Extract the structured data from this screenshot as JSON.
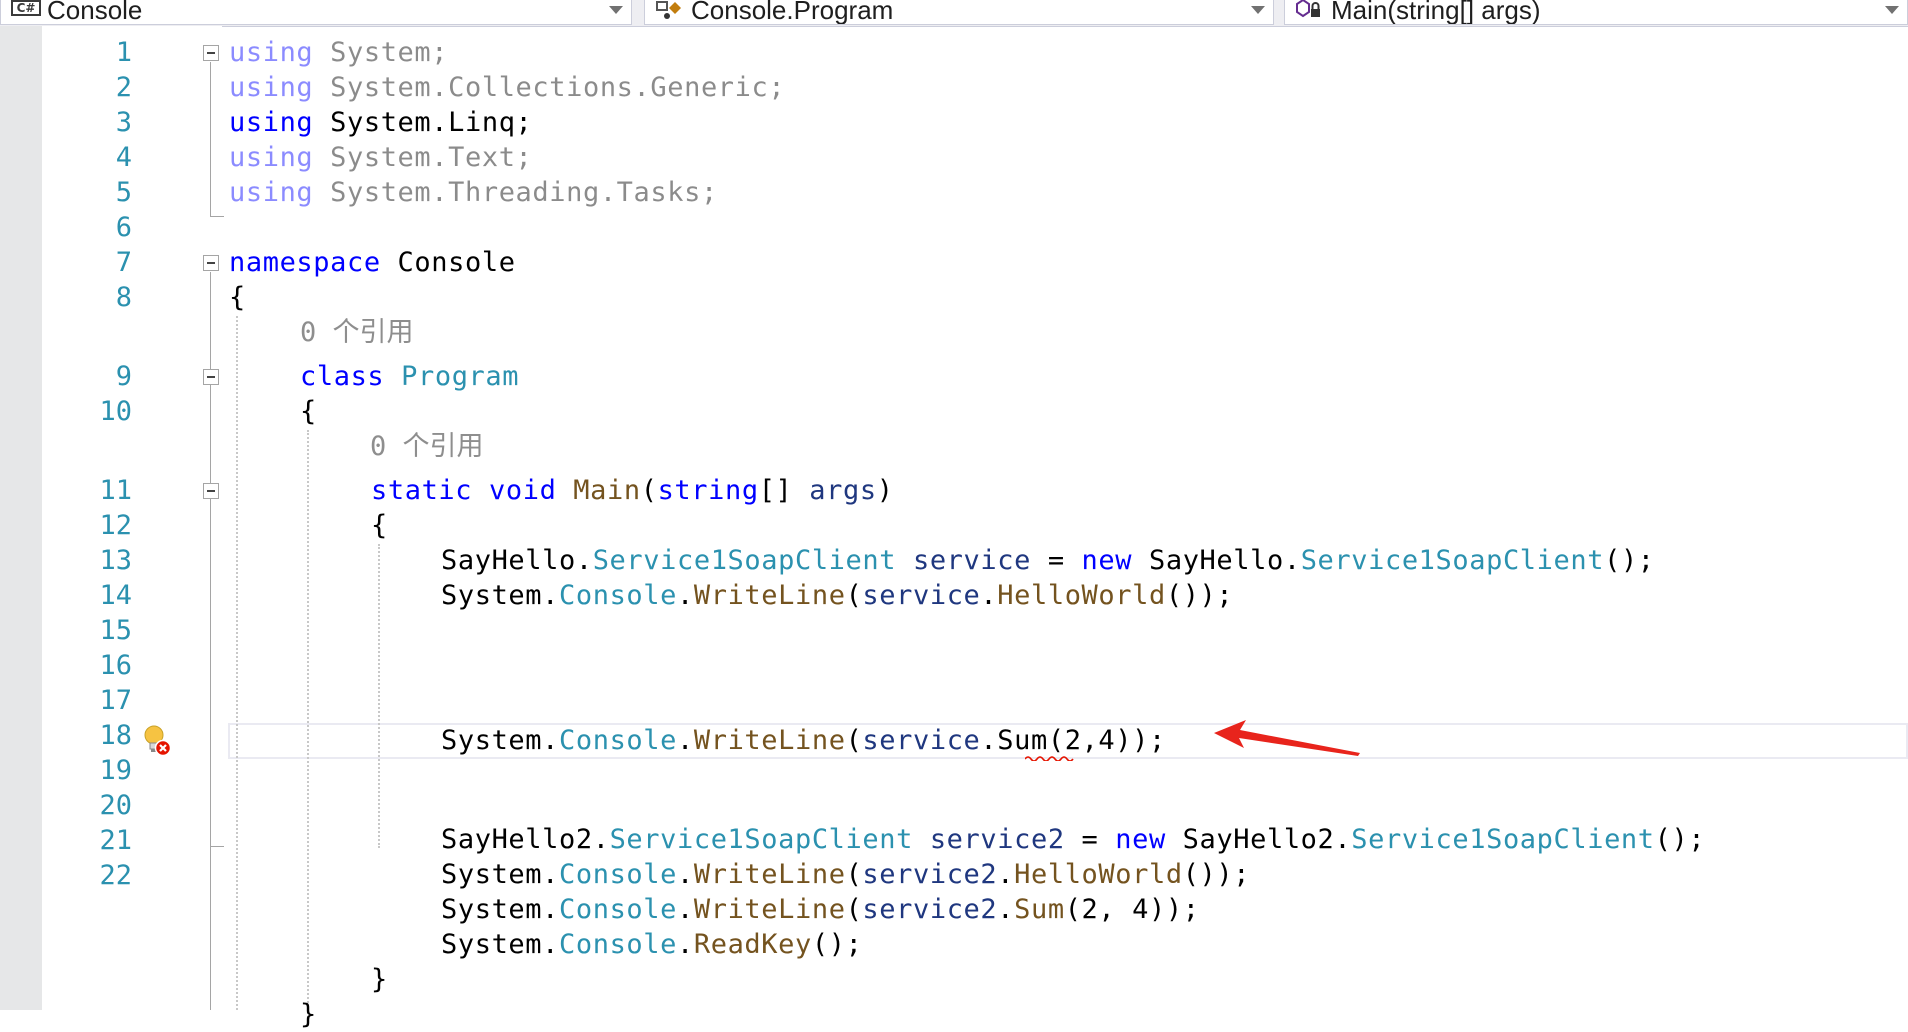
{
  "navbar": {
    "project": "Console",
    "type_scope": "Console.Program",
    "member": "Main(string[] args)",
    "project_icon": "csharp-project-icon",
    "type_icon": "class-icon",
    "member_icon": "method-icon"
  },
  "codelens": {
    "program_refs": "0 个引用",
    "main_refs": "0 个引用"
  },
  "line_numbers": [
    "1",
    "2",
    "3",
    "4",
    "5",
    "6",
    "7",
    "8",
    "9",
    "10",
    "11",
    "12",
    "13",
    "14",
    "15",
    "16",
    "17",
    "18",
    "19",
    "20",
    "21",
    "22"
  ],
  "code": {
    "l1": {
      "kw": "using",
      "rest": " System;"
    },
    "l2": {
      "kw": "using",
      "rest": " System.Collections.Generic;"
    },
    "l3": {
      "kw": "using",
      "rest": " System.Linq;"
    },
    "l4": {
      "kw": "using",
      "rest": " System.Text;"
    },
    "l5": {
      "kw": "using",
      "rest": " System.Threading.Tasks;"
    },
    "l7": {
      "kw": "namespace",
      "rest": " Console"
    },
    "l8": "{",
    "l9": {
      "kw": "class",
      "sp": " ",
      "ty": "Program"
    },
    "l10": "{",
    "l11": {
      "kw1": "static",
      "sp1": " ",
      "kw2": "void",
      "sp2": " ",
      "mt": "Main",
      "p1": "(",
      "kw3": "string",
      "p2": "[] ",
      "pm": "args",
      "p3": ")"
    },
    "l12": "{",
    "l13": {
      "a": "SayHello.",
      "ty1": "Service1SoapClient",
      "sp": " ",
      "pm": "service",
      "b": " = ",
      "kw": "new",
      "c": " SayHello.",
      "ty2": "Service1SoapClient",
      "d": "();"
    },
    "l14": {
      "a": "System.",
      "ty": "Console",
      "b": ".",
      "mt1": "WriteLine",
      "c": "(",
      "pm": "service",
      "d": ".",
      "mt2": "HelloWorld",
      "e": "());"
    },
    "l15": {
      "a": "System.",
      "ty": "Console",
      "b": ".",
      "mt": "WriteLine",
      "c": "(",
      "pm": "service",
      "d": ".",
      "err": "Sum",
      "e": "(2,4));"
    },
    "l17": {
      "a": "SayHello2.",
      "ty1": "Service1SoapClient",
      "sp": " ",
      "pm": "service2",
      "b": " = ",
      "kw": "new",
      "c": " SayHello2.",
      "ty2": "Service1SoapClient",
      "d": "();"
    },
    "l18": {
      "a": "System.",
      "ty": "Console",
      "b": ".",
      "mt1": "WriteLine",
      "c": "(",
      "pm": "service2",
      "d": ".",
      "mt2": "HelloWorld",
      "e": "());"
    },
    "l19": {
      "a": "System.",
      "ty": "Console",
      "b": ".",
      "mt1": "WriteLine",
      "c": "(",
      "pm": "service2",
      "d": ".",
      "mt2": "Sum",
      "e": "(2, 4));"
    },
    "l20": {
      "a": "System.",
      "ty": "Console",
      "b": ".",
      "mt": "ReadKey",
      "c": "();"
    },
    "l21": "}",
    "l22": "}"
  },
  "colors": {
    "keyword": "#0000ff",
    "type": "#2b91af",
    "method": "#74531f",
    "local": "#1f377f",
    "line_number": "#2b91af",
    "error": "#e51400",
    "annotation_arrow": "#e8241c"
  }
}
